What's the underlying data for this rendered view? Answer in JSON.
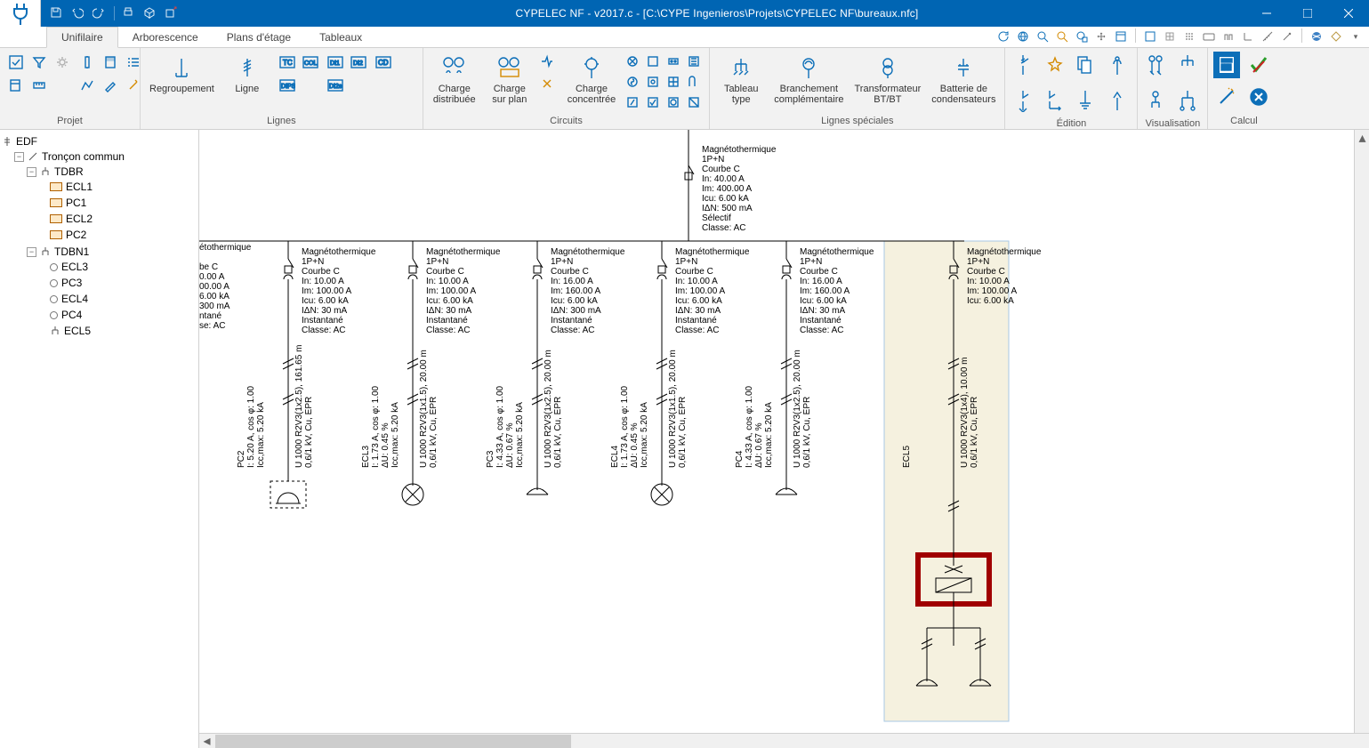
{
  "title": "CYPELEC NF - v2017.c - [C:\\CYPE Ingenieros\\Projets\\CYPELEC NF\\bureaux.nfc]",
  "tabs": {
    "unifilaire": "Unifilaire",
    "arborescence": "Arborescence",
    "plans": "Plans d'étage",
    "tableaux": "Tableaux"
  },
  "ribbon": {
    "projet": "Projet",
    "lignes": "Lignes",
    "regroupement": "Regroupement",
    "ligne": "Ligne",
    "circuits": "Circuits",
    "charge_dist": "Charge\ndistribuée",
    "charge_plan": "Charge\nsur plan",
    "charge_conc": "Charge\nconcentrée",
    "lignes_spec": "Lignes spéciales",
    "tab_type": "Tableau\ntype",
    "branch": "Branchement\ncomplémentaire",
    "transfo": "Transformateur\nBT/BT",
    "batt": "Batterie de\ncondensateurs",
    "edition": "Édition",
    "visualisation": "Visualisation",
    "calcul": "Calcul"
  },
  "tree": {
    "edf": "EDF",
    "troncon": "Tronçon commun",
    "tdbr": "TDBR",
    "ecl1": "ECL1",
    "pc1": "PC1",
    "ecl2": "ECL2",
    "pc2": "PC2",
    "tdbn1": "TDBN1",
    "ecl3": "ECL3",
    "pc3": "PC3",
    "ecl4": "ECL4",
    "pc4": "PC4",
    "ecl5": "ECL5"
  },
  "breaker_main": {
    "l1": "Magnétothermique",
    "l2": "1P+N",
    "l3": "Courbe C",
    "l4": "In: 40.00 A",
    "l5": "Im: 400.00 A",
    "l6": "Icu: 6.00 kA",
    "l7": "IΔN: 500 mA",
    "l8": "Sélectif",
    "l9": "Classe: AC"
  },
  "breaker_cut": {
    "l1": "étothermique",
    "l3": "be C",
    "l4": "0.00 A",
    "l5": "00.00 A",
    "l6": "6.00 kA",
    "l7": "300 mA",
    "l8": "ntané",
    "l9": "se: AC"
  },
  "breaker10": {
    "l1": "Magnétothermique",
    "l2": "1P+N",
    "l3": "Courbe C",
    "l4": "In: 10.00 A",
    "l5": "Im: 100.00 A",
    "l6": "Icu: 6.00 kA",
    "l7": "IΔN: 30 mA",
    "l8": "Instantané",
    "l9": "Classe: AC"
  },
  "breaker16": {
    "l1": "Magnétothermique",
    "l2": "1P+N",
    "l3": "Courbe C",
    "l4": "In: 16.00 A",
    "l5": "Im: 160.00 A",
    "l6": "Icu: 6.00 kA",
    "l7": "IΔN: 300 mA",
    "l8": "Instantané",
    "l9": "Classe: AC"
  },
  "breaker16b": {
    "l1": "Magnétothermique",
    "l2": "1P+N",
    "l3": "Courbe C",
    "l4": "In: 16.00 A",
    "l5": "Im: 160.00 A",
    "l6": "Icu: 6.00 kA",
    "l7": "IΔN: 30 mA",
    "l8": "Instantané",
    "l9": "Classe: AC"
  },
  "breaker10s": {
    "l1": "Magnétothermique",
    "l2": "1P+N",
    "l3": "Courbe C",
    "l4": "In: 10.00 A",
    "l5": "Im: 100.00 A",
    "l6": "Icu: 6.00 kA"
  },
  "load_pc2": {
    "a": "PC2",
    "b": "I: 5.20 A, cos φ: 1.00",
    "c": "Icc,max: 5.20 kA"
  },
  "load_ecl3": {
    "a": "ECL3",
    "b": "I: 1.73 A, cos φ: 1.00",
    "c": "ΔU: 0.45 %",
    "d": "Icc,max: 5.20 kA"
  },
  "load_pc3": {
    "a": "PC3",
    "b": "I: 4.33 A, cos φ: 1.00",
    "c": "ΔU: 0.67 %",
    "d": "Icc,max: 5.20 kA"
  },
  "load_ecl4": {
    "a": "ECL4",
    "b": "I: 1.73 A, cos φ: 1.00",
    "c": "ΔU: 0.45 %",
    "d": "Icc,max: 5.20 kA"
  },
  "load_pc4": {
    "a": "PC4",
    "b": "I: 4.33 A, cos φ: 1.00",
    "c": "ΔU: 0.67 %",
    "d": "Icc,max: 5.20 kA"
  },
  "load_ecl5": {
    "a": "ECL5"
  },
  "cable161": {
    "a": "U 1000 R2V3(1x2.5), 161.65 m",
    "b": "0,6/1 kV, Cu, EPR"
  },
  "cable151": {
    "a": "U 1000 R2V3(1x1.5), 20.00 m",
    "b": "0,6/1 kV, Cu, EPR"
  },
  "cable252": {
    "a": "U 1000 R2V3(1x2.5), 20.00 m",
    "b": "0,6/1 kV, Cu, EPR"
  },
  "cable4": {
    "a": "U 1000 R2V3(1x4), 10.00 m",
    "b": "0,6/1 kV, Cu, EPR"
  }
}
